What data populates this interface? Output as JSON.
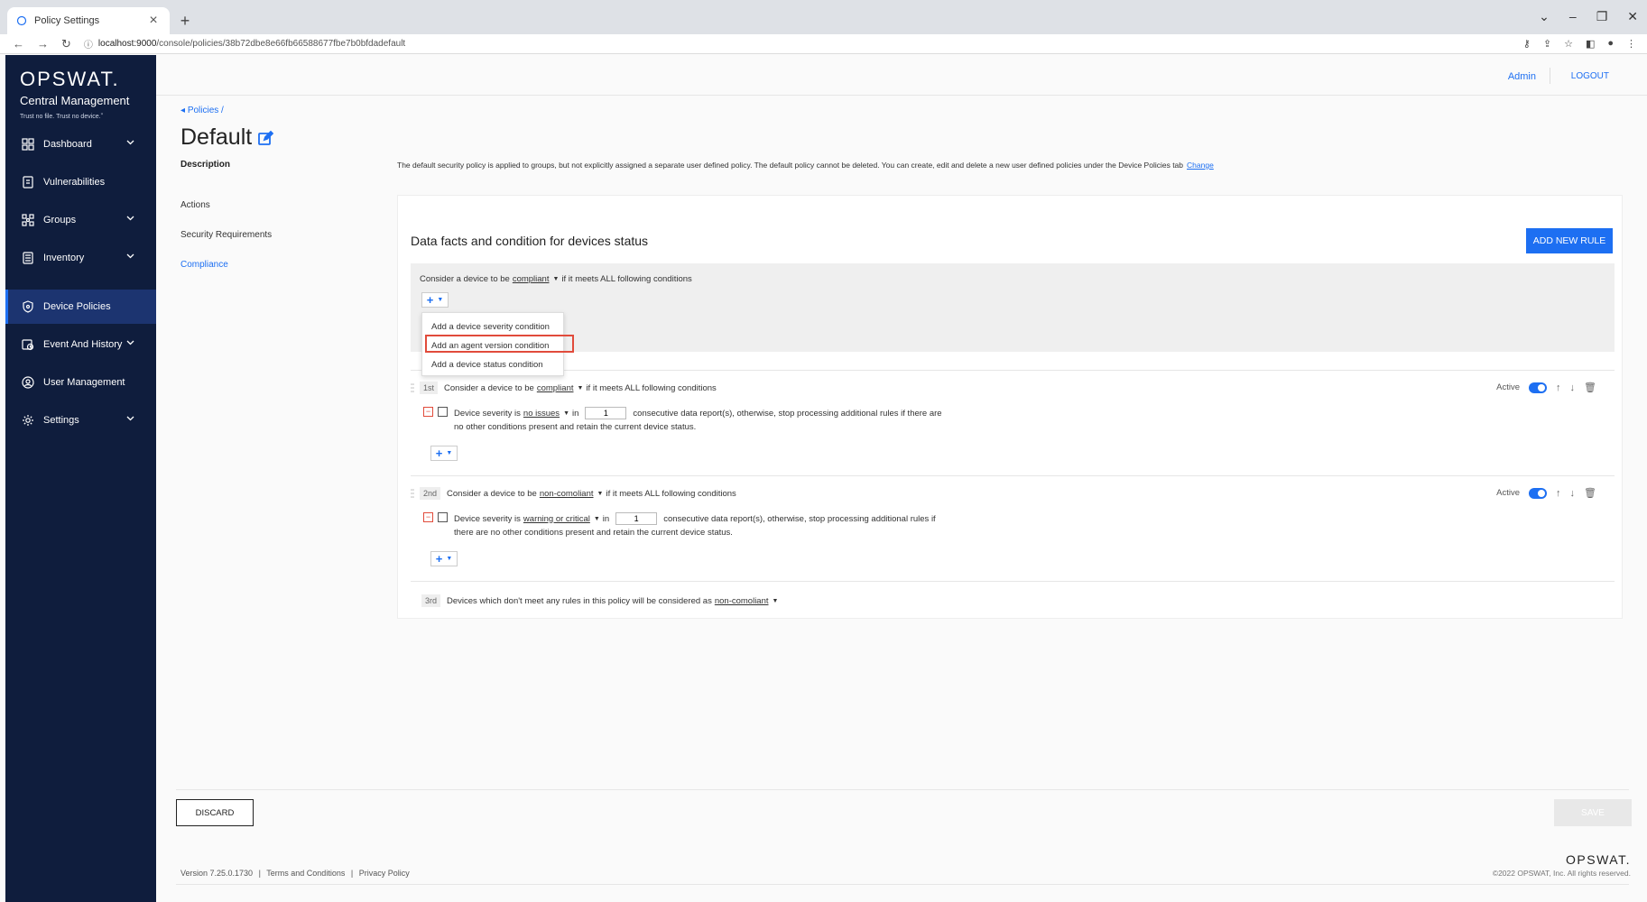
{
  "browser": {
    "tab_title": "Policy Settings",
    "url_host": "localhost:9000",
    "url_path": "/console/policies/38b72dbe8e66fb66588677fbe7b0bfdadefault"
  },
  "brand": {
    "logo": "OPSWAT.",
    "product": "Central Management",
    "tagline": "Trust no file. Trust no device.ˮ"
  },
  "sidebar": {
    "items": [
      {
        "label": "Dashboard",
        "icon": "dashboard-icon",
        "chevron": true
      },
      {
        "label": "Vulnerabilities",
        "icon": "vulnerabilities-icon",
        "chevron": false
      },
      {
        "label": "Groups",
        "icon": "groups-icon",
        "chevron": true
      },
      {
        "label": "Inventory",
        "icon": "inventory-icon",
        "chevron": true
      },
      {
        "label": "Device Policies",
        "icon": "shield-icon",
        "chevron": false,
        "active": true
      },
      {
        "label": "Event And History",
        "icon": "history-icon",
        "chevron": true
      },
      {
        "label": "User Management",
        "icon": "user-icon",
        "chevron": false
      },
      {
        "label": "Settings",
        "icon": "gear-icon",
        "chevron": true
      }
    ]
  },
  "header": {
    "admin": "Admin",
    "logout": "LOGOUT"
  },
  "page": {
    "breadcrumb": "Policies /",
    "title": "Default",
    "left_nav": {
      "description": "Description",
      "actions": "Actions",
      "security": "Security Requirements",
      "compliance": "Compliance"
    },
    "description_text": "The default security policy is applied to groups, but not explicitly assigned a separate user defined policy. The default policy cannot be deleted. You can create, edit and delete a new user defined policies under the Device Policies tab",
    "description_link": "Change"
  },
  "compliance": {
    "title": "Data facts and condition for devices status",
    "add_rule": "ADD NEW RULE",
    "draft": {
      "prefix": "Consider a device to be",
      "status": "compliant",
      "suffix": "if it meets ALL following conditions"
    },
    "menu": {
      "items": [
        "Add a device severity condition",
        "Add an agent version condition",
        "Add a device status condition"
      ]
    },
    "rules": [
      {
        "order": "1st",
        "prefix": "Consider a device to be",
        "status": "compliant",
        "suffix": "if it meets ALL following conditions",
        "active_label": "Active",
        "cond_prefix": "Device severity is",
        "cond_value": "no issues",
        "cond_in": "in",
        "cond_count": "1",
        "cond_line1": "consecutive data report(s), otherwise, stop processing additional rules if there are",
        "cond_line2": "no other conditions present and retain the current device status."
      },
      {
        "order": "2nd",
        "prefix": "Consider a device to be",
        "status": "non-comoliant",
        "suffix": "if it meets ALL following conditions",
        "active_label": "Active",
        "cond_prefix": "Device severity is",
        "cond_value": "warning or critical",
        "cond_in": "in",
        "cond_count": "1",
        "cond_line1": "consecutive data report(s), otherwise, stop processing additional rules if",
        "cond_line2": "there are no other conditions present and retain the current device status."
      }
    ],
    "fallback": {
      "order": "3rd",
      "text": "Devices which don't meet any rules in this policy will be considered as",
      "status": "non-comoliant"
    }
  },
  "actions": {
    "discard": "DISCARD",
    "save": "SAVE"
  },
  "footer": {
    "version": "Version 7.25.0.1730",
    "terms": "Terms and Conditions",
    "privacy": "Privacy Policy",
    "sep": "|",
    "logo": "OPSWAT.",
    "copyright": "©2022 OPSWAT, Inc. All rights reserved."
  },
  "colors": {
    "sidebar": "#0f1d3d",
    "accent": "#1d6ff2",
    "highlight": "#e14b3b"
  }
}
